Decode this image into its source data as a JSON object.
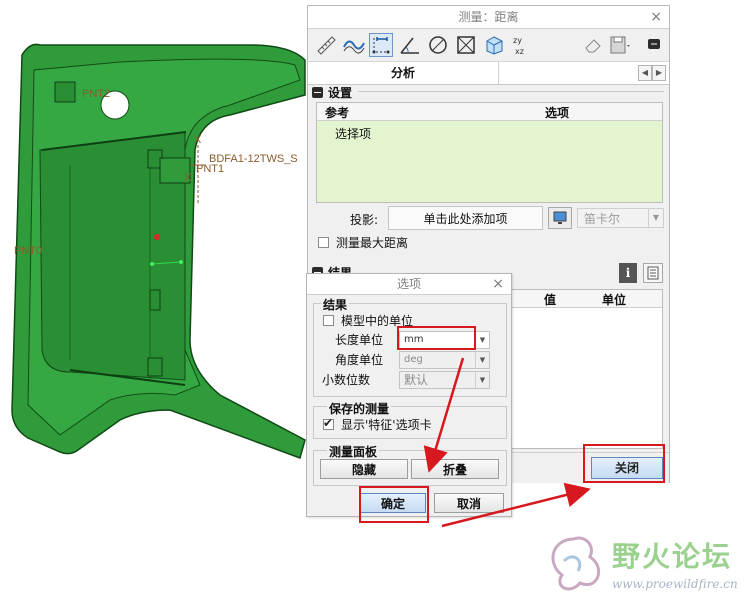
{
  "model": {
    "labels": [
      "PNT2",
      "PNT1",
      "BDFA1-12TWS_S",
      "PNT0"
    ],
    "axis_mark": "X"
  },
  "main_dialog": {
    "title": "测量：距离",
    "close_glyph": "×",
    "toolbar_icons": [
      "ruler-icon",
      "curve-icon",
      "distance-icon",
      "angle-icon",
      "diameter-icon",
      "area-icon",
      "volume-icon",
      "transform-icon",
      "eraser-icon",
      "save-icon",
      "collapse-icon"
    ],
    "tab": "分析",
    "settings": {
      "heading": "设置",
      "col_ref": "参考",
      "col_opt": "选项",
      "ref_item": "选择项",
      "proj_label": "投影:",
      "proj_button": "单击此处添加项",
      "coord_value": "笛卡尔",
      "max_dist_label": "测量最大距离",
      "max_dist_checked": false
    },
    "results": {
      "heading": "结果",
      "col_value": "值",
      "col_unit": "单位",
      "info_glyph": "i"
    },
    "close_button": "关闭"
  },
  "options_dialog": {
    "title": "选项",
    "close_glyph": "×",
    "results_group": {
      "title": "结果",
      "model_units_label": "模型中的单位",
      "model_units_checked": false,
      "length_unit_label": "长度单位",
      "length_unit_value": "mm",
      "angle_unit_label": "角度单位",
      "angle_unit_value": "deg",
      "decimal_label": "小数位数",
      "decimal_value": "默认"
    },
    "saved_group": {
      "title": "保存的测量",
      "show_feature_tab_label": "显示'特征'选项卡",
      "show_feature_tab_checked": true
    },
    "panel_group": {
      "title": "测量面板",
      "hide_button": "隐藏",
      "collapse_button": "折叠"
    },
    "ok_button": "确定",
    "cancel_button": "取消"
  },
  "annotation_color": "#d8181f",
  "watermark": {
    "title": "野火论坛",
    "url": "www.proewildfire.cn"
  }
}
